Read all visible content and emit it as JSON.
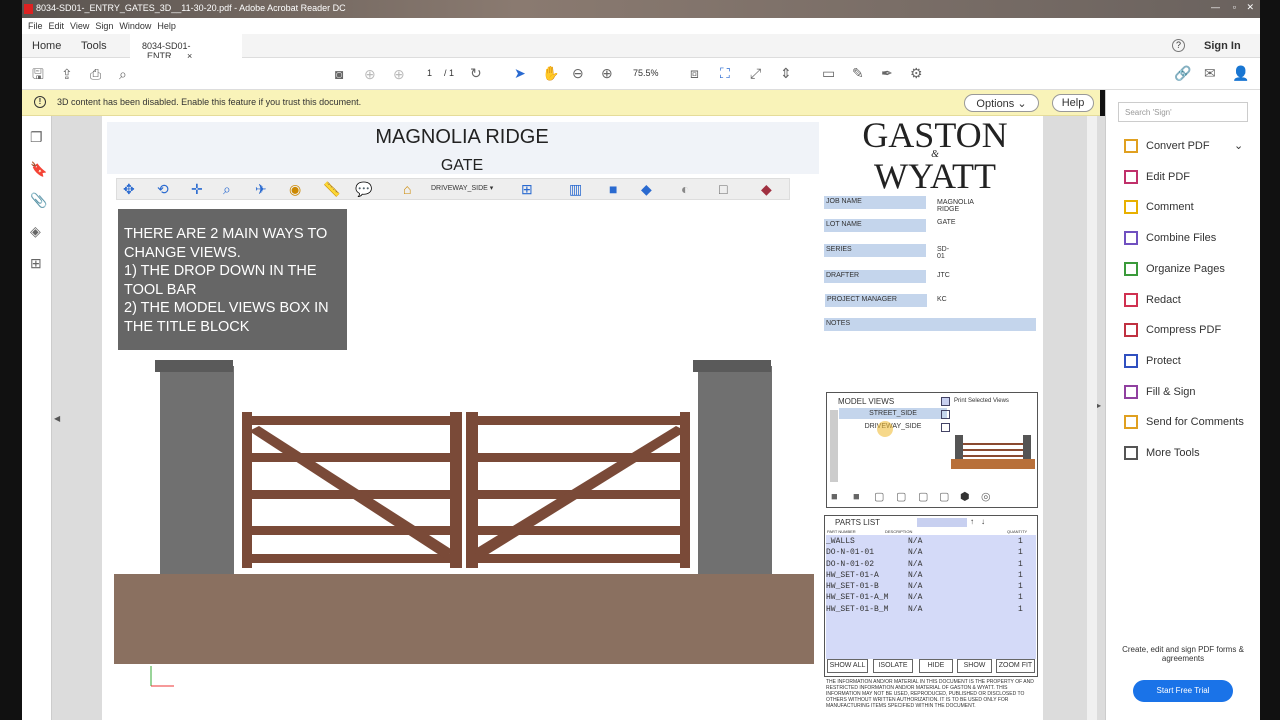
{
  "window": {
    "title": "8034-SD01-_ENTRY_GATES_3D__11-30-20.pdf - Adobe Acrobat Reader DC"
  },
  "menu": [
    "File",
    "Edit",
    "View",
    "Sign",
    "Window",
    "Help"
  ],
  "tabs": {
    "home": "Home",
    "tools": "Tools",
    "doc": "8034-SD01-_ENTR...",
    "close": "×",
    "help": "?",
    "signin": "Sign In"
  },
  "toolbar": {
    "page_current": "1",
    "page_total": "/ 1",
    "zoom": "75.5%"
  },
  "notice": {
    "text": "3D content has been disabled. Enable this feature if you trust this document.",
    "options": "Options",
    "help": "Help"
  },
  "search": {
    "placeholder": "Search 'Sign'"
  },
  "tools": [
    "Convert PDF",
    "Edit PDF",
    "Comment",
    "Combine Files",
    "Organize Pages",
    "Redact",
    "Compress PDF",
    "Protect",
    "Fill & Sign",
    "Send for Comments",
    "More Tools"
  ],
  "tool_colors": [
    "#e0a020",
    "#c0306a",
    "#e8b000",
    "#7050c0",
    "#3a9a3a",
    "#d03050",
    "#c03040",
    "#3050c0",
    "#9040a0",
    "#e0a020",
    "#555555"
  ],
  "promo": {
    "text": "Create, edit and sign PDF forms & agreements",
    "button": "Start Free Trial"
  },
  "doc": {
    "title": "MAGNOLIA RIDGE",
    "subtitle": "GATE",
    "view_dropdown": "DRIVEWAY_SIDE",
    "note": "THERE ARE 2 MAIN WAYS TO CHANGE VIEWS.\n1) THE DROP DOWN IN THE TOOL BAR\n2) THE MODEL VIEWS BOX IN THE TITLE BLOCK",
    "logo": {
      "line1": "GASTON",
      "amp": "&",
      "line2": "WYATT"
    },
    "fields": [
      {
        "label": "JOB NAME",
        "value": "MAGNOLIA RIDGE"
      },
      {
        "label": "LOT NAME",
        "value": "GATE"
      },
      {
        "label": "SERIES",
        "value": "SD-01"
      },
      {
        "label": "DRAFTER",
        "value": "JTC"
      },
      {
        "label": "PROJECT MANAGER",
        "value": "KC"
      }
    ],
    "notes_label": "NOTES",
    "model_views": {
      "title": "MODEL VIEWS",
      "print_label": "Print Selected Views",
      "items": [
        "STREET_SIDE",
        "DRIVEWAY_SIDE"
      ]
    },
    "parts": {
      "title": "PARTS LIST",
      "col_part": "PART NUMBER",
      "col_desc": "DESCRIPTION",
      "col_qty": "QUANTITY",
      "rows": [
        [
          "_WALLS",
          "N/A",
          "1"
        ],
        [
          "DO-N-01-01",
          "N/A",
          "1"
        ],
        [
          "DO-N-01-02",
          "N/A",
          "1"
        ],
        [
          "HW_SET-01-A",
          "N/A",
          "1"
        ],
        [
          "HW_SET-01-B",
          "N/A",
          "1"
        ],
        [
          "HW_SET-01-A_M",
          "N/A",
          "1"
        ],
        [
          "HW_SET-01-B_M",
          "N/A",
          "1"
        ]
      ],
      "buttons": [
        "SHOW ALL",
        "ISOLATE",
        "HIDE",
        "SHOW",
        "ZOOM FIT"
      ]
    },
    "disclaimer": "THE INFORMATION AND/OR MATERIAL IN THIS DOCUMENT IS THE PROPERTY OF AND RESTRICTED INFORMATION AND/OR MATERIAL OF GASTON & WYATT. THIS INFORMATION MAY NOT BE USED, REPRODUCED, PUBLISHED OR DISCLOSED TO OTHERS WITHOUT WRITTEN AUTHORIZATION. IT IS TO BE USED ONLY FOR MANUFACTURING ITEMS SPECIFIED WITHIN THE DOCUMENT."
  }
}
